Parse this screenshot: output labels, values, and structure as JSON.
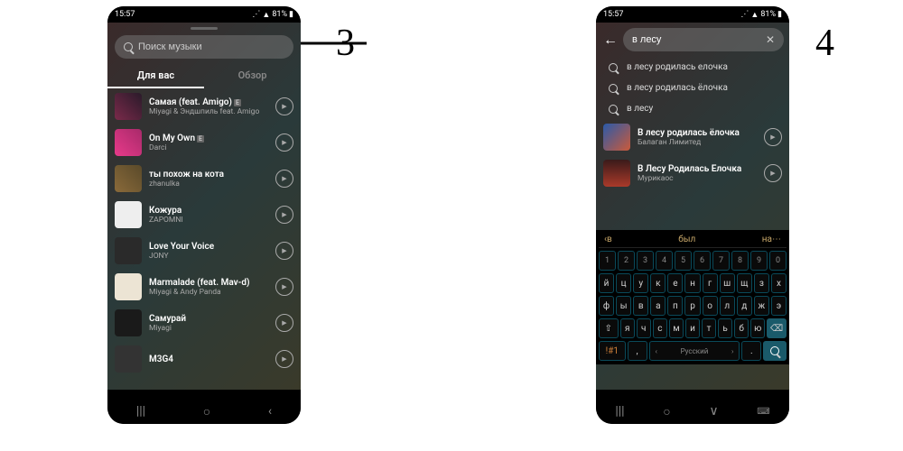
{
  "status": {
    "time": "15:57",
    "battery": "81%"
  },
  "labels": {
    "step3": "3",
    "step4": "4"
  },
  "screen1": {
    "search_placeholder": "Поиск музыки",
    "tabs": {
      "for_you": "Для вас",
      "browse": "Обзор"
    },
    "tracks": [
      {
        "title": "Самая (feat. Amigo)",
        "artist": "Miyagi & Эндшпиль feat. Amigo",
        "explicit": true
      },
      {
        "title": "On My Own",
        "artist": "Darci",
        "explicit": true
      },
      {
        "title": "ты похож на кота",
        "artist": "zhanulka",
        "explicit": false
      },
      {
        "title": "Кожура",
        "artist": "ZAPOMNI",
        "explicit": false
      },
      {
        "title": "Love Your Voice",
        "artist": "JONY",
        "explicit": false
      },
      {
        "title": "Marmalade (feat. Mav-d)",
        "artist": "Miyagi & Andy Panda",
        "explicit": false
      },
      {
        "title": "Самурай",
        "artist": "Miyagi",
        "explicit": false
      },
      {
        "title": "M3G4",
        "artist": "",
        "explicit": false
      }
    ]
  },
  "screen2": {
    "search_value": "в лесу",
    "suggestions": [
      "в лесу родилась елочка",
      "в лесу родилась ёлочка",
      "в лесу"
    ],
    "results": [
      {
        "title": "В лесу родилась ёлочка",
        "artist": "Балаган Лимитед"
      },
      {
        "title": "В Лесу Родилась Ёлочка",
        "artist": "Мурикаос"
      }
    ],
    "keyboard": {
      "predictions": {
        "left": "в",
        "mid": "был",
        "right": "на"
      },
      "row_num": [
        "1",
        "2",
        "3",
        "4",
        "5",
        "6",
        "7",
        "8",
        "9",
        "0"
      ],
      "row1": [
        "й",
        "ц",
        "у",
        "к",
        "е",
        "н",
        "г",
        "ш",
        "щ",
        "з",
        "х"
      ],
      "row2": [
        "ф",
        "ы",
        "в",
        "а",
        "п",
        "р",
        "о",
        "л",
        "д",
        "ж",
        "э"
      ],
      "row3_shift": "⇧",
      "row3": [
        "я",
        "ч",
        "с",
        "м",
        "и",
        "т",
        "ь",
        "б",
        "ю"
      ],
      "row3_bksp": "⌫",
      "row4": {
        "sym": "!#1",
        "comma": ",",
        "space": "Русский",
        "dot": ".",
        "search": "🔍"
      }
    }
  }
}
